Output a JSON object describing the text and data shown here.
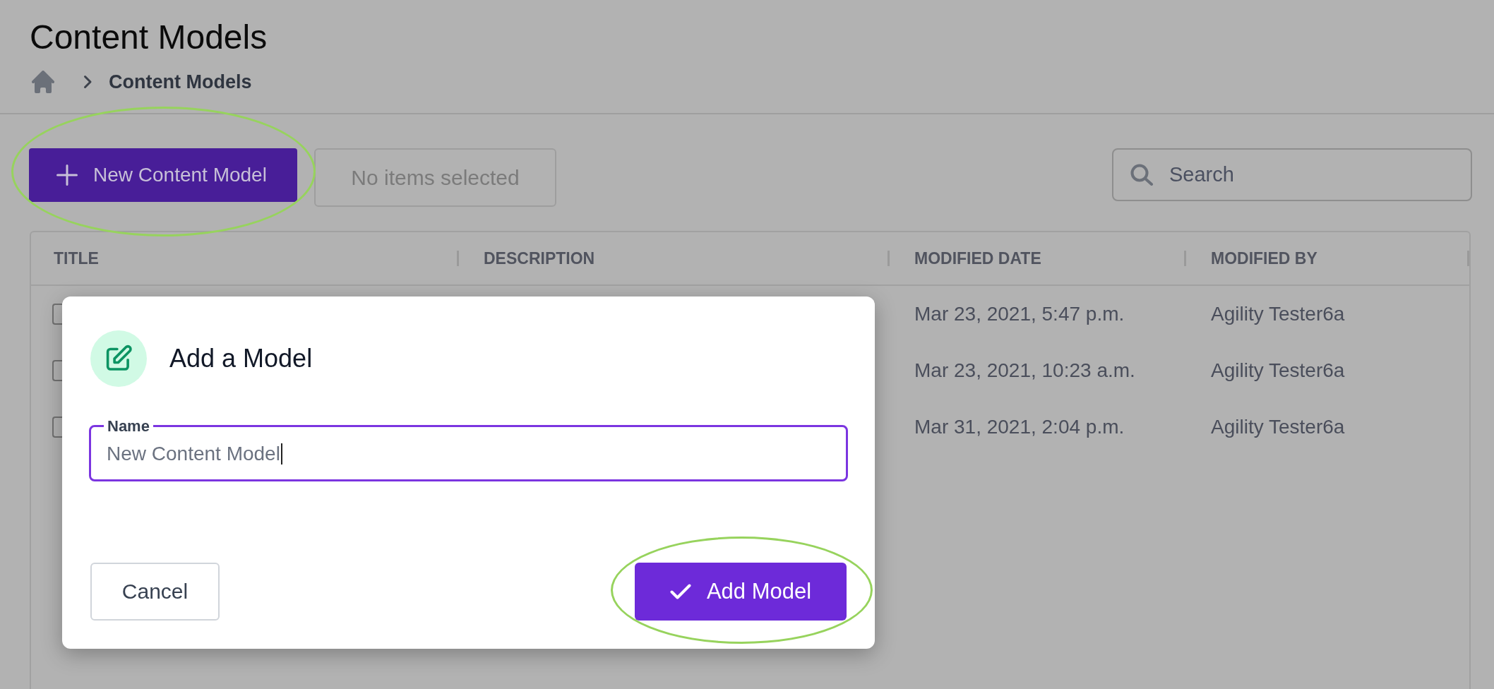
{
  "page": {
    "title": "Content Models"
  },
  "breadcrumb": {
    "items": [
      {
        "label": "Content Models"
      }
    ]
  },
  "toolbar": {
    "new_button": {
      "label": "New Content Model",
      "highlighted": true
    },
    "selection_button": {
      "label": "No items selected",
      "disabled": true
    },
    "search": {
      "placeholder": "Search"
    }
  },
  "table": {
    "columns": [
      {
        "label": "TITLE"
      },
      {
        "label": "DESCRIPTION"
      },
      {
        "label": "MODIFIED DATE"
      },
      {
        "label": "MODIFIED BY"
      }
    ],
    "rows": [
      {
        "checked": false,
        "modified_date": "Mar 23, 2021, 5:47 p.m.",
        "modified_by": "Agility Tester6a"
      },
      {
        "checked": false,
        "modified_date": "Mar 23, 2021, 10:23 a.m.",
        "modified_by": "Agility Tester6a"
      },
      {
        "checked": false,
        "modified_date": "Mar 31, 2021, 2:04 p.m.",
        "modified_by": "Agility Tester6a"
      }
    ]
  },
  "dialog": {
    "title": "Add a Model",
    "field": {
      "label": "Name",
      "value": "New Content Model",
      "focused": true
    },
    "buttons": [
      {
        "label": "Cancel",
        "kind": "secondary",
        "highlighted": false
      },
      {
        "label": "Add Model",
        "kind": "primary",
        "highlighted": true
      }
    ]
  }
}
